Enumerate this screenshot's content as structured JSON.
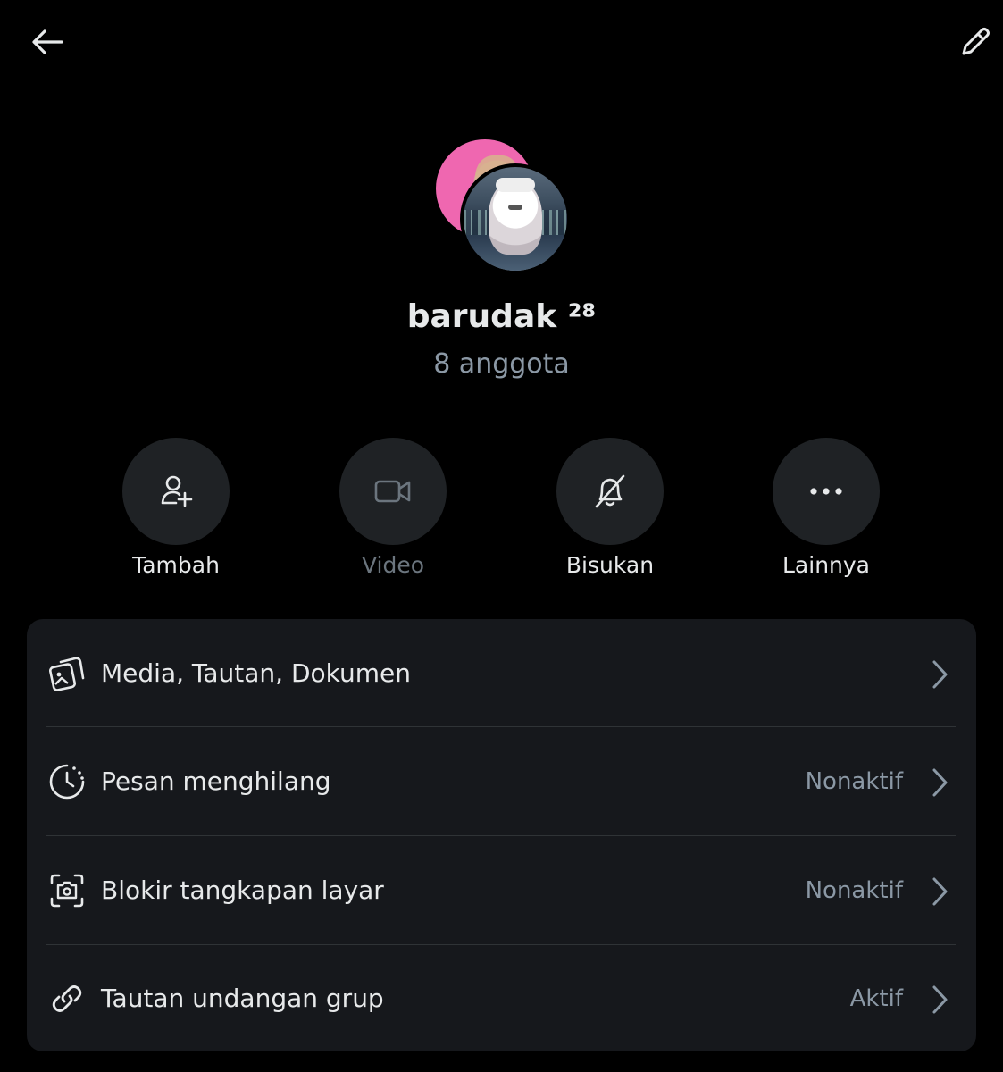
{
  "header": {
    "back_label": "back",
    "edit_label": "edit"
  },
  "group": {
    "name": "barudak ²⁸",
    "members": "8 anggota"
  },
  "actions": [
    {
      "label": "Tambah",
      "icon": "add-person-icon",
      "enabled": true
    },
    {
      "label": "Video",
      "icon": "video-camera-icon",
      "enabled": false
    },
    {
      "label": "Bisukan",
      "icon": "bell-off-icon",
      "enabled": true
    },
    {
      "label": "Lainnya",
      "icon": "more-dots-icon",
      "enabled": true
    }
  ],
  "settings": [
    {
      "label": "Media, Tautan, Dokumen",
      "status": "",
      "icon": "media-icon"
    },
    {
      "label": "Pesan menghilang",
      "status": "Nonaktif",
      "icon": "timer-icon"
    },
    {
      "label": "Blokir tangkapan layar",
      "status": "Nonaktif",
      "icon": "screenshot-icon"
    },
    {
      "label": "Tautan undangan grup",
      "status": "Aktif",
      "icon": "link-icon"
    }
  ],
  "colors": {
    "background": "#000000",
    "card": "#16181c",
    "circle": "#1f2225",
    "text": "#e7e9ea",
    "muted": "#8b98a5"
  }
}
